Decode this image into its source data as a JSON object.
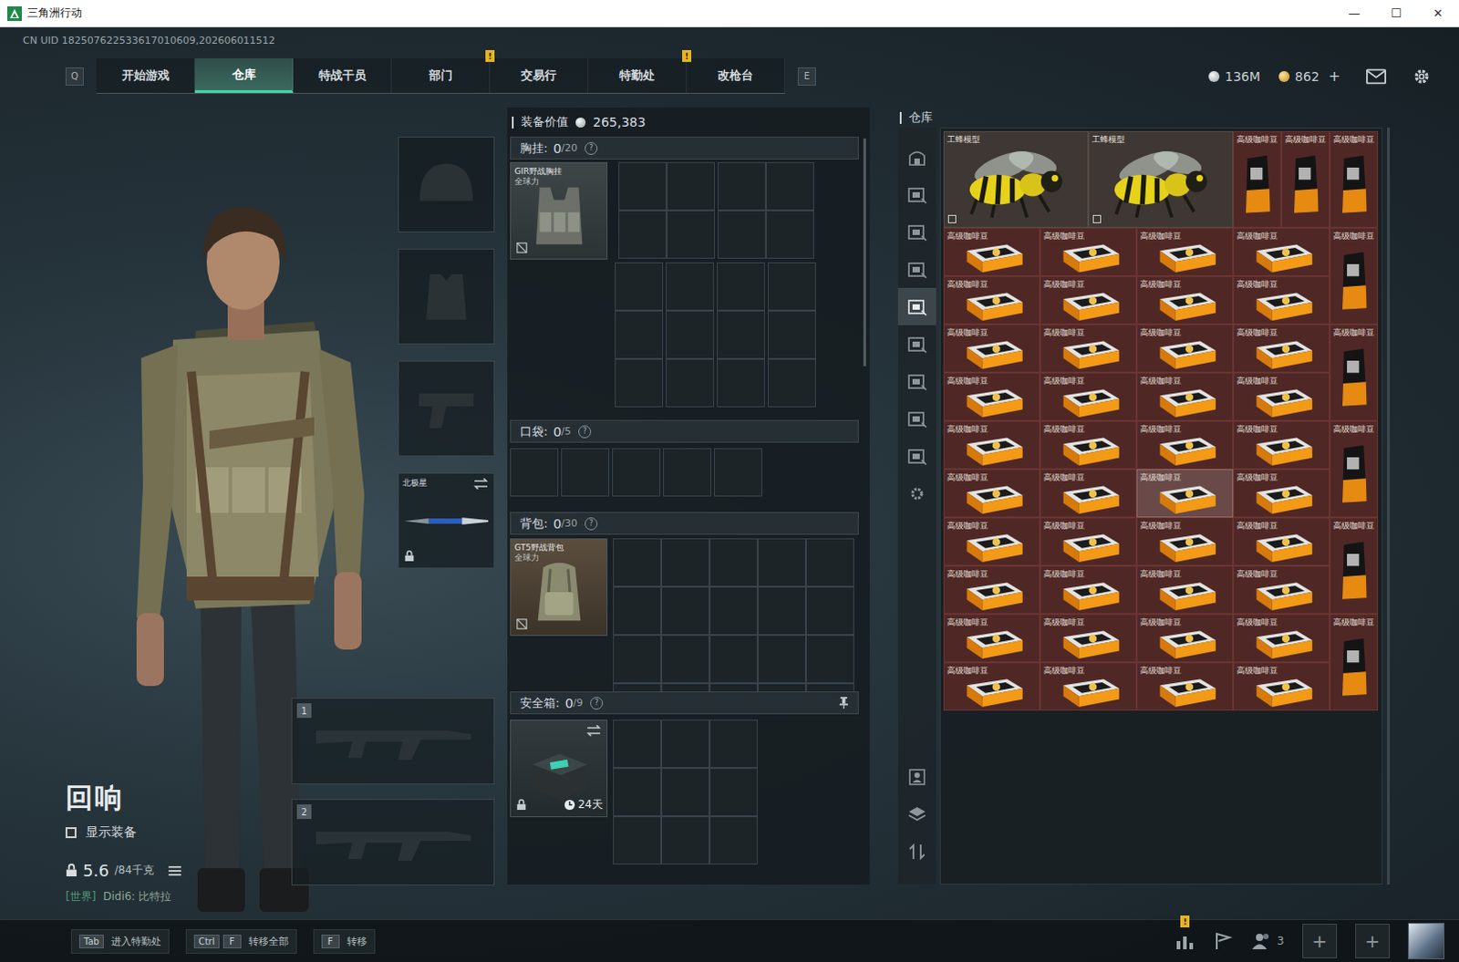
{
  "window": {
    "title": "三角洲行动",
    "controls": [
      "—",
      "☐",
      "✕"
    ]
  },
  "uid": "CN UID 182507622533617010609,202606011512",
  "nav": {
    "left_key": "Q",
    "right_key": "E",
    "alert_mark": "!",
    "tabs": [
      {
        "label": "开始游戏",
        "selected": false,
        "alert": false
      },
      {
        "label": "仓库",
        "selected": true,
        "alert": false
      },
      {
        "label": "特战干员",
        "selected": false,
        "alert": false
      },
      {
        "label": "部门",
        "selected": false,
        "alert": true
      },
      {
        "label": "交易行",
        "selected": false,
        "alert": false
      },
      {
        "label": "特勤处",
        "selected": false,
        "alert": true
      },
      {
        "label": "改枪台",
        "selected": false,
        "alert": false
      }
    ]
  },
  "currencies": [
    {
      "kind": "silver",
      "value": "136M"
    },
    {
      "kind": "gold",
      "value": "862",
      "add": "+"
    }
  ],
  "operator": {
    "name": "回响",
    "show_gear": {
      "label": "显示装备",
      "checked": false
    },
    "weight": "5.6",
    "weight_limit": "/84千克",
    "chat": {
      "channel": "[世界]",
      "text": "Didi6: 比特拉"
    }
  },
  "gear_slots": [
    {
      "kind": "helmet",
      "locked": false
    },
    {
      "kind": "armor",
      "locked": false
    },
    {
      "kind": "pistol",
      "locked": false
    },
    {
      "kind": "melee",
      "label": "北极星",
      "locked": true
    }
  ],
  "weapon_slots": [
    {
      "number": "1"
    },
    {
      "number": "2"
    }
  ],
  "loadout": {
    "value_label": "装备价值",
    "value": "265,383",
    "sections": [
      {
        "kind": "chest",
        "title": "胸挂:",
        "count": "0",
        "capacity": "/20",
        "help": "?",
        "item": {
          "name": "GIR野战胸挂",
          "brand": "全球力"
        }
      },
      {
        "kind": "pockets",
        "title": "口袋:",
        "count": "0",
        "capacity": "/5",
        "help": "?"
      },
      {
        "kind": "backpack",
        "title": "背包:",
        "count": "0",
        "capacity": "/30",
        "help": "?",
        "item": {
          "name": "GT5野战背包",
          "brand": "全球力"
        }
      },
      {
        "kind": "safe",
        "title": "安全箱:",
        "count": "0",
        "capacity": "/9",
        "help": "?",
        "pinned": true,
        "item": {
          "timer": "24天"
        }
      }
    ]
  },
  "warehouse": {
    "title": "仓库",
    "tabs": [
      {
        "selected": false
      },
      {
        "selected": false
      },
      {
        "selected": false
      },
      {
        "selected": false
      },
      {
        "selected": true
      },
      {
        "selected": false
      },
      {
        "selected": false
      },
      {
        "selected": false
      },
      {
        "selected": false
      },
      {
        "selected": false
      }
    ],
    "tools": [
      {
        "kind": "person"
      },
      {
        "kind": "layers"
      },
      {
        "kind": "sort"
      }
    ],
    "items": [
      {
        "name": "工蜂模型",
        "kind": "bee",
        "highlighted": false
      },
      {
        "name": "工蜂模型",
        "kind": "bee",
        "highlighted": false
      },
      {
        "name": "高级咖啡豆",
        "kind": "bag",
        "highlighted": false
      },
      {
        "name": "高级咖啡豆",
        "kind": "bag",
        "highlighted": false
      },
      {
        "name": "高级咖啡豆",
        "kind": "bag",
        "highlighted": false
      },
      {
        "name": "高级咖啡豆",
        "kind": "box",
        "highlighted": false
      },
      {
        "name": "高级咖啡豆",
        "kind": "box",
        "highlighted": false
      },
      {
        "name": "高级咖啡豆",
        "kind": "box",
        "highlighted": false
      },
      {
        "name": "高级咖啡豆",
        "kind": "box",
        "highlighted": false
      },
      {
        "name": "高级咖啡豆",
        "kind": "bag",
        "highlighted": false
      },
      {
        "name": "高级咖啡豆",
        "kind": "box",
        "highlighted": false
      },
      {
        "name": "高级咖啡豆",
        "kind": "box",
        "highlighted": false
      },
      {
        "name": "高级咖啡豆",
        "kind": "box",
        "highlighted": false
      },
      {
        "name": "高级咖啡豆",
        "kind": "box",
        "highlighted": false
      },
      {
        "name": "高级咖啡豆",
        "kind": "box",
        "highlighted": false
      },
      {
        "name": "高级咖啡豆",
        "kind": "box",
        "highlighted": false
      },
      {
        "name": "高级咖啡豆",
        "kind": "box",
        "highlighted": false
      },
      {
        "name": "高级咖啡豆",
        "kind": "box",
        "highlighted": false
      },
      {
        "name": "高级咖啡豆",
        "kind": "bag",
        "highlighted": false
      },
      {
        "name": "高级咖啡豆",
        "kind": "box",
        "highlighted": false
      },
      {
        "name": "高级咖啡豆",
        "kind": "box",
        "highlighted": false
      },
      {
        "name": "高级咖啡豆",
        "kind": "box",
        "highlighted": false
      },
      {
        "name": "高级咖啡豆",
        "kind": "box",
        "highlighted": false
      },
      {
        "name": "高级咖啡豆",
        "kind": "box",
        "highlighted": false
      },
      {
        "name": "高级咖啡豆",
        "kind": "box",
        "highlighted": false
      },
      {
        "name": "高级咖啡豆",
        "kind": "box",
        "highlighted": false
      },
      {
        "name": "高级咖啡豆",
        "kind": "box",
        "highlighted": false
      },
      {
        "name": "高级咖啡豆",
        "kind": "bag",
        "highlighted": false
      },
      {
        "name": "高级咖啡豆",
        "kind": "box",
        "highlighted": false
      },
      {
        "name": "高级咖啡豆",
        "kind": "box",
        "highlighted": false
      },
      {
        "name": "高级咖啡豆",
        "kind": "box",
        "highlighted": true
      },
      {
        "name": "高级咖啡豆",
        "kind": "box",
        "highlighted": false
      },
      {
        "name": "高级咖啡豆",
        "kind": "box",
        "highlighted": false
      },
      {
        "name": "高级咖啡豆",
        "kind": "box",
        "highlighted": false
      },
      {
        "name": "高级咖啡豆",
        "kind": "box",
        "highlighted": false
      },
      {
        "name": "高级咖啡豆",
        "kind": "box",
        "highlighted": false
      },
      {
        "name": "高级咖啡豆",
        "kind": "bag",
        "highlighted": false
      },
      {
        "name": "高级咖啡豆",
        "kind": "box",
        "highlighted": false
      },
      {
        "name": "高级咖啡豆",
        "kind": "box",
        "highlighted": false
      },
      {
        "name": "高级咖啡豆",
        "kind": "box",
        "highlighted": false
      },
      {
        "name": "高级咖啡豆",
        "kind": "box",
        "highlighted": false
      },
      {
        "name": "高级咖啡豆",
        "kind": "box",
        "highlighted": false
      },
      {
        "name": "高级咖啡豆",
        "kind": "box",
        "highlighted": false
      },
      {
        "name": "高级咖啡豆",
        "kind": "box",
        "highlighted": false
      },
      {
        "name": "高级咖啡豆",
        "kind": "box",
        "highlighted": false
      },
      {
        "name": "高级咖啡豆",
        "kind": "bag",
        "highlighted": false
      },
      {
        "name": "高级咖啡豆",
        "kind": "box",
        "highlighted": false
      },
      {
        "name": "高级咖啡豆",
        "kind": "box",
        "highlighted": false
      },
      {
        "name": "高级咖啡豆",
        "kind": "box",
        "highlighted": false
      },
      {
        "name": "高级咖啡豆",
        "kind": "box",
        "highlighted": false
      }
    ]
  },
  "bottom_bar": {
    "hints": [
      {
        "keys": [
          "Tab"
        ],
        "label": "进入特勤处"
      },
      {
        "keys": [
          "Ctrl",
          "F"
        ],
        "label": "转移全部"
      },
      {
        "keys": [
          "F"
        ],
        "label": "转移"
      }
    ],
    "alert_mark": "!",
    "stats_alert": true,
    "squad_count": "3",
    "party_slots": [
      "+",
      "+"
    ]
  }
}
